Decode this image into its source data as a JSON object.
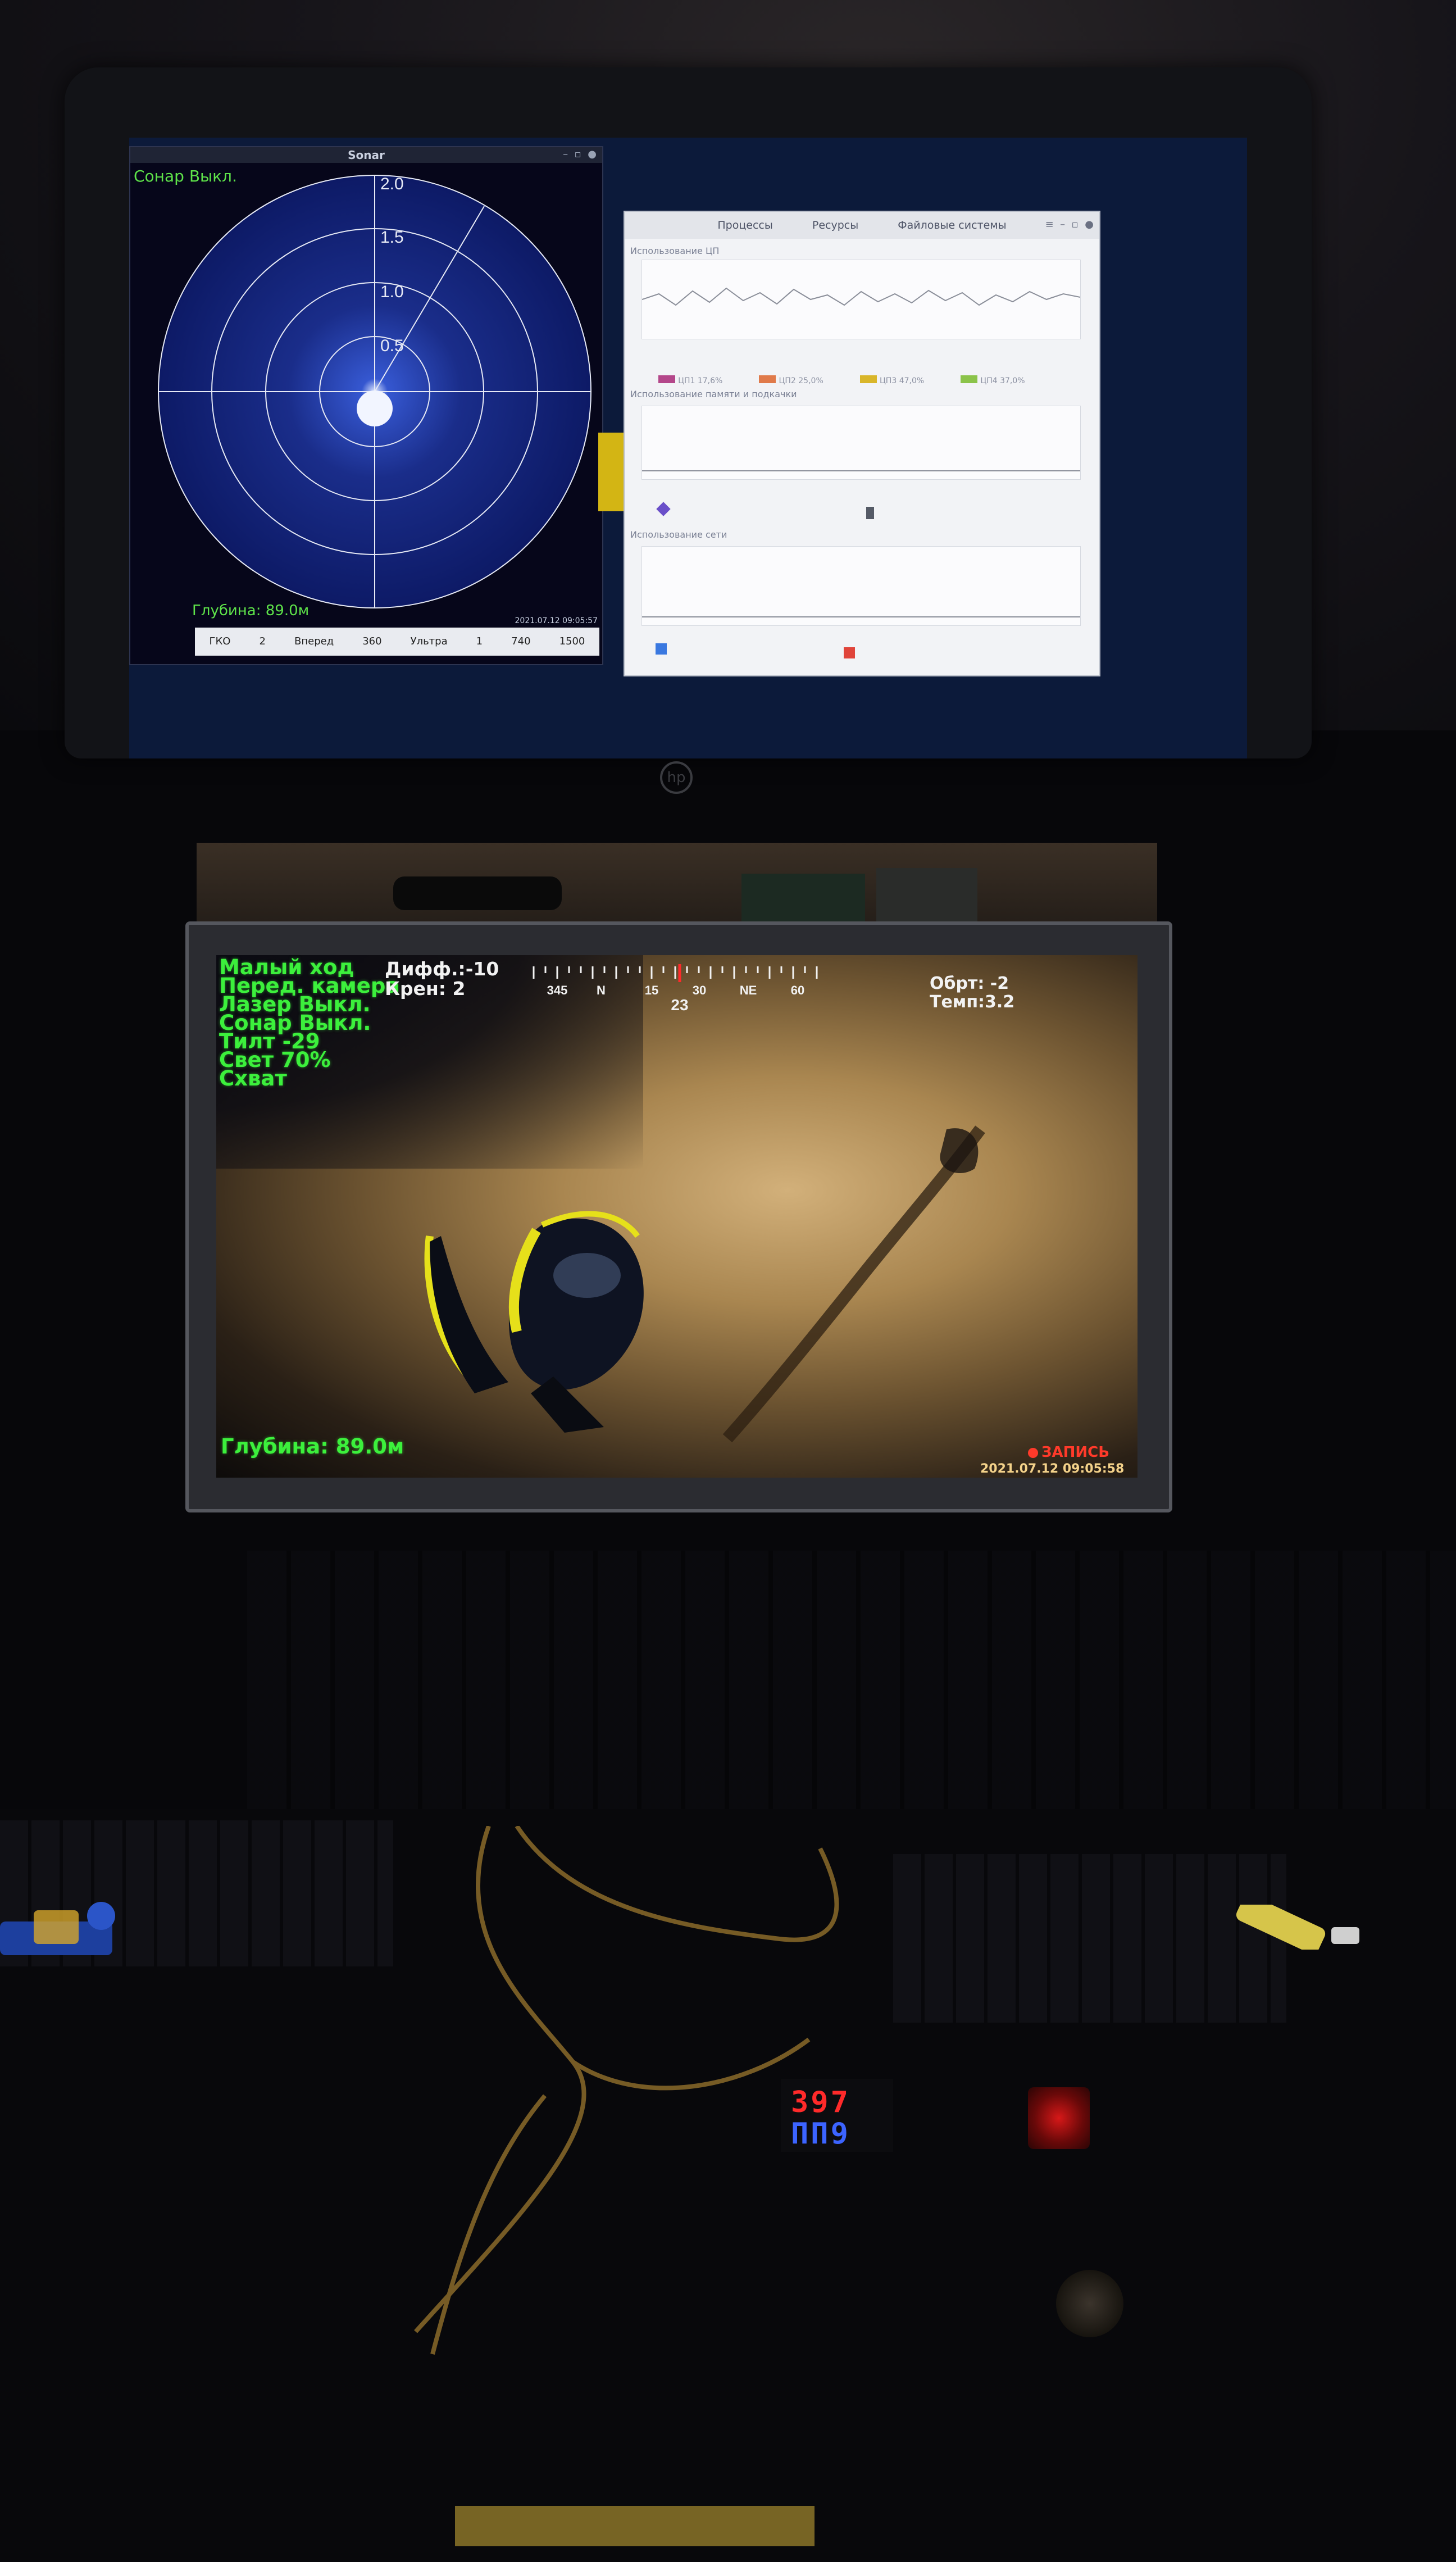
{
  "sonar": {
    "window_title": "Sonar",
    "status": "Сонар Выкл.",
    "ring_labels": [
      "2.0",
      "1.5",
      "1.0",
      "0.5"
    ],
    "depth": "Глубина: 89.0м",
    "datetime": "2021.07.12 09:05:57",
    "bar_items": [
      "ГКО",
      "2",
      "Вперед",
      "360",
      "Ультра",
      "1",
      "740",
      "1500"
    ]
  },
  "monitor": {
    "tabs": [
      "Процессы",
      "Ресурсы",
      "Файловые системы"
    ],
    "section_cpu": "Использование ЦП",
    "section_memory": "Использование памяти и подкачки",
    "section_network": "Использование сети",
    "cpu_legend": [
      "ЦП1 17,6%",
      "ЦП2 25,0%",
      "ЦП3 47,0%",
      "ЦП4 37,0%"
    ],
    "cpu_legend_colors": [
      "#b4478a",
      "#e07a4a",
      "#d9b62a",
      "#8bc34a"
    ]
  },
  "osd": {
    "status_lines": [
      "Малый ход",
      "Перед. камера",
      "Лазер Выкл.",
      "Сонар Выкл.",
      "Тилт -29",
      "Свет 70%",
      "Схват"
    ],
    "diff": "Дифф.:-10",
    "roll": "Крен: 2",
    "compass_labels": [
      "345",
      "N",
      "15",
      "30",
      "NE",
      "60"
    ],
    "heading": "23",
    "trim": "Обрт: -2",
    "temp": "Темп:3.2",
    "depth": "Глубина: 89.0м",
    "recording": "ЗАПИСЬ",
    "datetime": "2021.07.12 09:05:58"
  },
  "console": {
    "voltmeter_top": "397",
    "voltmeter_bottom": "ПП9"
  },
  "colors": {
    "osd_green": "#3cf03c",
    "rec_red": "#ff3a2a",
    "sonar_green": "#5ee34a"
  }
}
